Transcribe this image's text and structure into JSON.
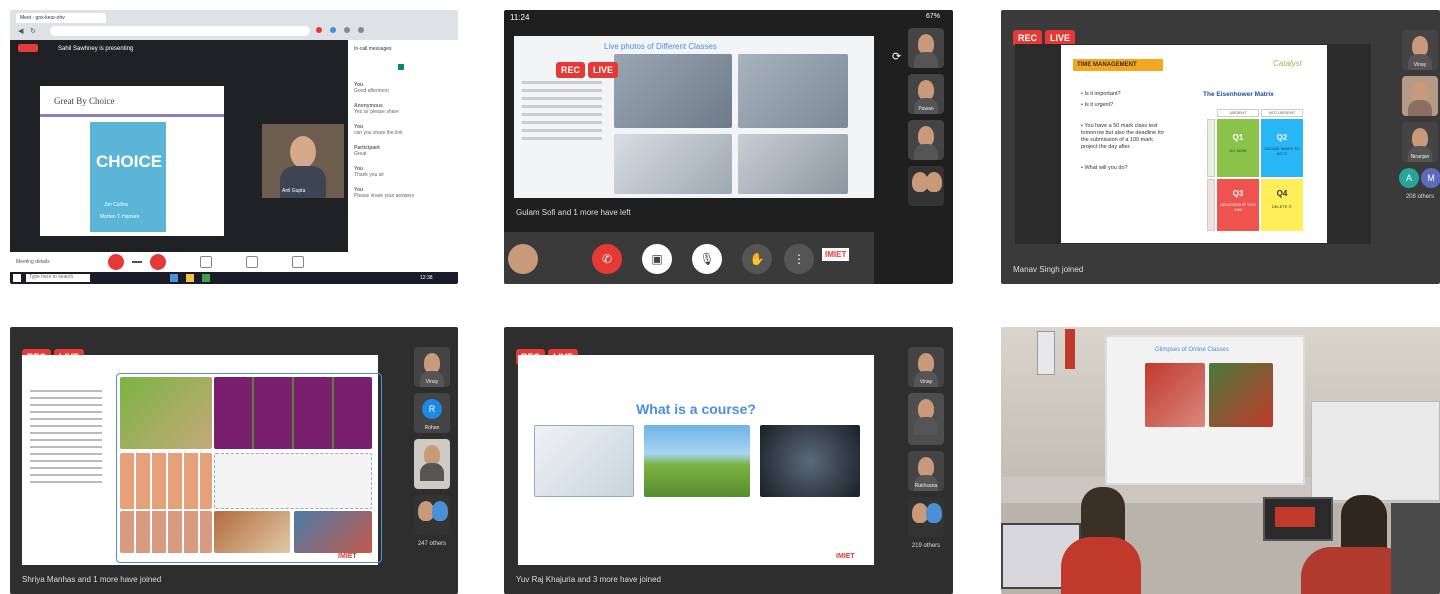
{
  "panel1": {
    "browser_tab": "Meet - gnx-keur-ohv",
    "presenting": "Sahil Sawhney is presenting",
    "slide_title": "Great By Choice",
    "book_title": "CHOICE",
    "book_authors": [
      "Jim Collins",
      "Morten T. Hansen"
    ],
    "presenter_name": "Anil Gupta",
    "chat_header": "In-call messages",
    "chat_messages": [
      {
        "name": "You",
        "text": "Good afternoon"
      },
      {
        "name": "Anonymous",
        "text": "Yes sir please share"
      },
      {
        "name": "You",
        "text": "can you share the link"
      },
      {
        "name": "Participant",
        "text": "Great"
      },
      {
        "name": "You",
        "text": "Thank you sir"
      },
      {
        "name": "You",
        "text": "Please share your answers"
      }
    ],
    "meeting_details": "Meeting details",
    "taskbar_search": "Type here to search",
    "clock": "12:38"
  },
  "panel2": {
    "status_time": "11:24",
    "status_battery": "67%",
    "slide_title": "Live photos of Different Classes",
    "rec": "REC",
    "live": "LIVE",
    "left_message": "Gulam Sofi and 1 more have left",
    "participant_name": "Pawan",
    "logo": "IMIET"
  },
  "panel3": {
    "rec": "REC",
    "live": "LIVE",
    "slide_header": "TIME MANAGEMENT",
    "matrix_title": "The Eisenhower Matrix",
    "bullets": [
      "Is it important?",
      "Is it urgent?",
      "You have a 50 mark class test tomorrow but also the deadline for the submission of a 100 mark project the day after.",
      "What will you do?"
    ],
    "matrix_cols": [
      "URGENT",
      "NOT URGENT"
    ],
    "quadrants": [
      {
        "label": "Q1",
        "sub": "DO NOW"
      },
      {
        "label": "Q2",
        "sub": "DECIDE WHEN TO DO IT"
      },
      {
        "label": "Q3",
        "sub": "DELEGATE IF YOU CAN"
      },
      {
        "label": "Q4",
        "sub": "DELETE IT"
      }
    ],
    "joined_message": "Manav Singh joined",
    "thumb_names": [
      "Vinay",
      "",
      "Niranjan"
    ],
    "others": "208 others",
    "logo": "Catalyst"
  },
  "panel4": {
    "rec": "REC",
    "live": "LIVE",
    "joined_message": "Shriya Manhas and 1 more have joined",
    "thumb_names": [
      "Vinay",
      "Rohan",
      ""
    ],
    "others": "247 others",
    "logo": "IMIET"
  },
  "panel5": {
    "rec": "REC",
    "live": "LIVE",
    "slide_title": "What is a course?",
    "joined_message": "Yuv Raj Khajuria and 3 more have joined",
    "thumb_names": [
      "Vinay",
      "",
      "Rukhsana"
    ],
    "others": "219 others",
    "logo": "IMIET"
  },
  "panel6": {
    "projected_title": "Glimpses of Online Classes"
  },
  "colors": {
    "rec_badge": "#e53935",
    "end_call": "#e53935",
    "meet_dark": "#2e2e2e",
    "slide_accent": "#4a90d9"
  }
}
